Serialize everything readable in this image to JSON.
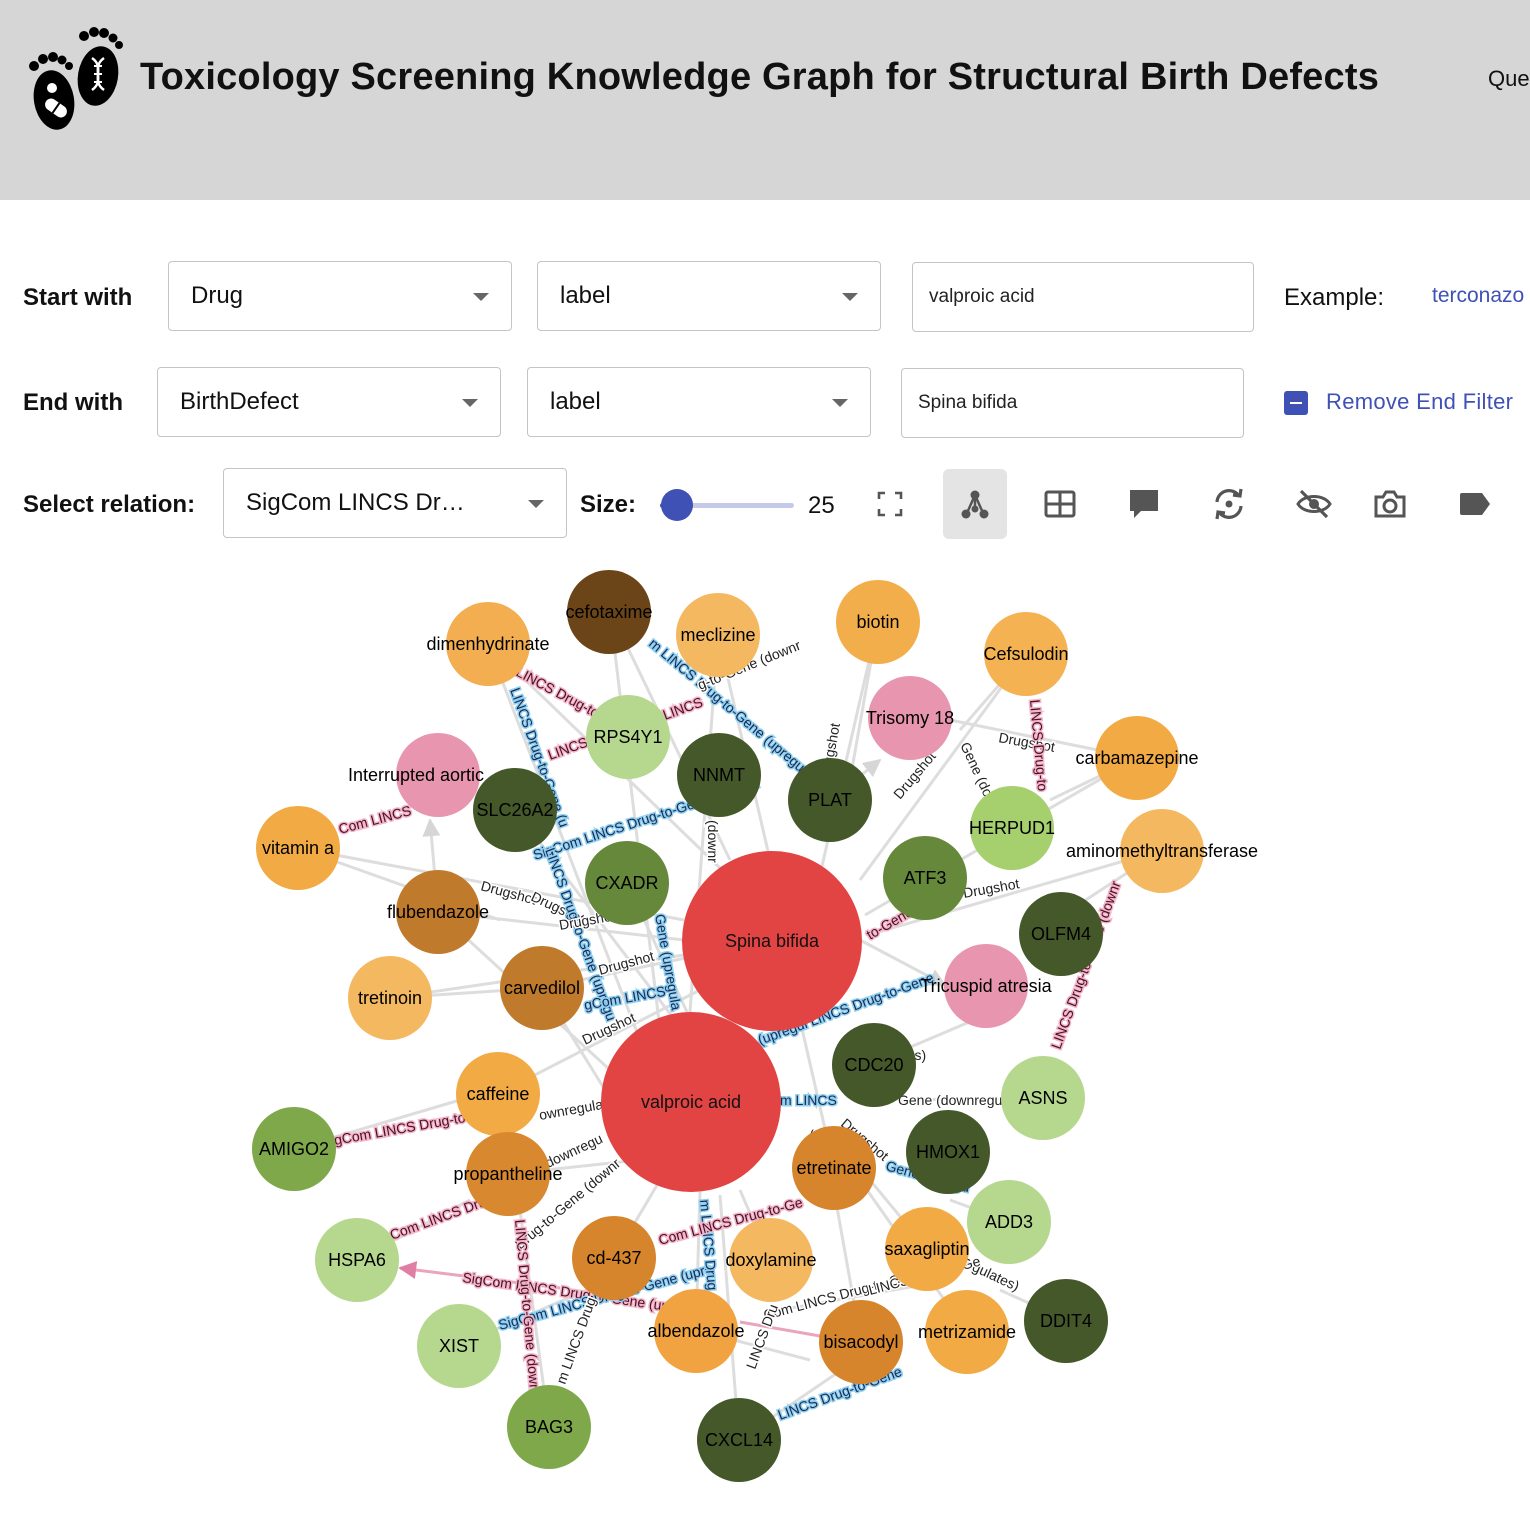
{
  "header": {
    "title": "Toxicology Screening Knowledge Graph for Structural Birth Defects",
    "nav_link": "Que"
  },
  "query": {
    "start_label": "Start with",
    "start_type": "Drug",
    "start_field": "label",
    "start_value": "valproic acid",
    "example_label": "Example:",
    "example_link": "terconazo",
    "end_label": "End with",
    "end_type": "BirthDefect",
    "end_field": "label",
    "end_value": "Spina bifida",
    "remove_end_filter": "Remove End Filter",
    "relation_label": "Select relation:",
    "relation_value": "SigCom LINCS Drug-to-Gene (upregulates)",
    "size_label": "Size:",
    "size_value": 25
  },
  "toolbar": {
    "icons": [
      "fullscreen-icon",
      "graph-layout-icon",
      "table-icon",
      "comment-icon",
      "refresh-icon",
      "visibility-off-icon",
      "camera-icon",
      "label-icon"
    ],
    "active": "graph-layout-icon"
  },
  "colors": {
    "header_bg": "#d6d6d6",
    "accent": "#3f51b5",
    "focus_node": "#e24343",
    "birth_defect": "#e895b0",
    "drug_light": "#f4b860",
    "drug_orange": "#f0a340",
    "drug_dark": "#bf7a2c",
    "drug_brown": "#6b4518",
    "gene_dark": "#44582a",
    "gene_mid": "#66883a",
    "gene_light": "#b5d78e"
  },
  "graph": {
    "nodes": [
      {
        "id": "spina-bifida",
        "label": "Spina bifida",
        "kind": "focus"
      },
      {
        "id": "valproic-acid",
        "label": "valproic acid",
        "kind": "focus"
      },
      {
        "id": "cefotaxime",
        "label": "cefotaxime",
        "kind": "drug_brown"
      },
      {
        "id": "dimenhydrinate",
        "label": "dimenhydrinate",
        "kind": "drug_light"
      },
      {
        "id": "meclizine",
        "label": "meclizine",
        "kind": "drug_light"
      },
      {
        "id": "biotin",
        "label": "biotin",
        "kind": "drug_orange"
      },
      {
        "id": "cefsulodin",
        "label": "Cefsulodin",
        "kind": "drug_light"
      },
      {
        "id": "trisomy-18",
        "label": "Trisomy 18",
        "kind": "birth_defect"
      },
      {
        "id": "rps4y1",
        "label": "RPS4Y1",
        "kind": "gene_light"
      },
      {
        "id": "carbamazepine",
        "label": "carbamazepine",
        "kind": "drug_orange"
      },
      {
        "id": "interrupted-aortic",
        "label": "Interrupted aortic",
        "kind": "birth_defect"
      },
      {
        "id": "nnmt",
        "label": "NNMT",
        "kind": "gene_dark"
      },
      {
        "id": "plat",
        "label": "PLAT",
        "kind": "gene_dark"
      },
      {
        "id": "slc26a2",
        "label": "SLC26A2",
        "kind": "gene_dark"
      },
      {
        "id": "herpud1",
        "label": "HERPUD1",
        "kind": "gene_light"
      },
      {
        "id": "aminomethyltransferase",
        "label": "aminomethyltransferase",
        "kind": "drug_light"
      },
      {
        "id": "vitamin-a",
        "label": "vitamin a",
        "kind": "drug_orange"
      },
      {
        "id": "cxadr",
        "label": "CXADR",
        "kind": "gene_mid"
      },
      {
        "id": "atf3",
        "label": "ATF3",
        "kind": "gene_mid"
      },
      {
        "id": "flubendazole",
        "label": "flubendazole",
        "kind": "drug_dark"
      },
      {
        "id": "olfm4",
        "label": "OLFM4",
        "kind": "gene_dark"
      },
      {
        "id": "tretinoin",
        "label": "tretinoin",
        "kind": "drug_light"
      },
      {
        "id": "carvedilol",
        "label": "carvedilol",
        "kind": "drug_dark"
      },
      {
        "id": "tricuspid-atresia",
        "label": "Tricuspid atresia",
        "kind": "birth_defect"
      },
      {
        "id": "cdc20",
        "label": "CDC20",
        "kind": "gene_dark"
      },
      {
        "id": "asns",
        "label": "ASNS",
        "kind": "gene_light"
      },
      {
        "id": "caffeine",
        "label": "caffeine",
        "kind": "drug_orange"
      },
      {
        "id": "amigo2",
        "label": "AMIGO2",
        "kind": "gene_mid"
      },
      {
        "id": "hmox1",
        "label": "HMOX1",
        "kind": "gene_dark"
      },
      {
        "id": "propantheline",
        "label": "propantheline",
        "kind": "drug_dark"
      },
      {
        "id": "etretinate",
        "label": "etretinate",
        "kind": "drug_dark"
      },
      {
        "id": "add3",
        "label": "ADD3",
        "kind": "gene_light"
      },
      {
        "id": "hspa6",
        "label": "HSPA6",
        "kind": "gene_light"
      },
      {
        "id": "cd-437",
        "label": "cd-437",
        "kind": "drug_dark"
      },
      {
        "id": "doxylamine",
        "label": "doxylamine",
        "kind": "drug_light"
      },
      {
        "id": "saxagliptin",
        "label": "saxagliptin",
        "kind": "drug_orange"
      },
      {
        "id": "ddit4",
        "label": "DDIT4",
        "kind": "gene_dark"
      },
      {
        "id": "xist",
        "label": "XIST",
        "kind": "gene_light"
      },
      {
        "id": "albendazole",
        "label": "albendazole",
        "kind": "drug_orange"
      },
      {
        "id": "bisacodyl",
        "label": "bisacodyl",
        "kind": "drug_dark"
      },
      {
        "id": "metrizamide",
        "label": "metrizamide",
        "kind": "drug_orange"
      },
      {
        "id": "bag3",
        "label": "BAG3",
        "kind": "gene_mid"
      },
      {
        "id": "cxcl14",
        "label": "CXCL14",
        "kind": "gene_dark"
      }
    ],
    "edge_labels": [
      "SigCom LINCS Drug-to-Gene (downregulates)",
      "SigCom LINCS Drug-to-Gene (upregulates)",
      "Drugshot"
    ]
  }
}
